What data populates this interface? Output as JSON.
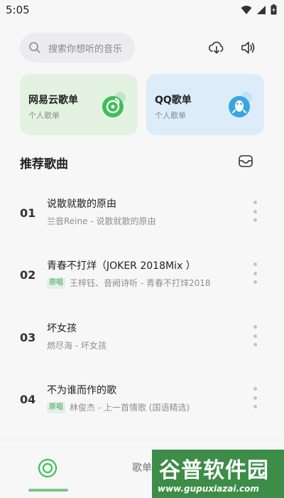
{
  "status_bar": {
    "time": "5:05"
  },
  "search": {
    "placeholder": "搜索你想听的音乐"
  },
  "cards": [
    {
      "title": "网易云歌单",
      "subtitle": "个人歌单"
    },
    {
      "title": "QQ歌单",
      "subtitle": "个人歌单"
    }
  ],
  "section": {
    "title": "推荐歌曲"
  },
  "songs": [
    {
      "index": "01",
      "title": "说散就散的原由",
      "tag": "",
      "subtitle": "兰音Reine - 说散就散的原由"
    },
    {
      "index": "02",
      "title": "青春不打烊（JOKER 2018Mix ）",
      "tag": "原唱",
      "subtitle": "王梓钰、音阙诗听 - 青春不打烊2018"
    },
    {
      "index": "03",
      "title": "坏女孩",
      "tag": "",
      "subtitle": "燃尽海 - 坏女孩"
    },
    {
      "index": "04",
      "title": "不为谁而作的歌",
      "tag": "原唱",
      "subtitle": "林俊杰 - 上一首情歌 (国语精选)"
    }
  ],
  "bottom_nav": {
    "playlist_label": "歌单"
  },
  "watermark": {
    "main": "谷普软件园",
    "url": "www.gupuxiazai.com"
  },
  "colors": {
    "accent_green": "#3fbf5a",
    "qq_blue": "#3aa6e0",
    "tag_green": "#3fa35a"
  }
}
